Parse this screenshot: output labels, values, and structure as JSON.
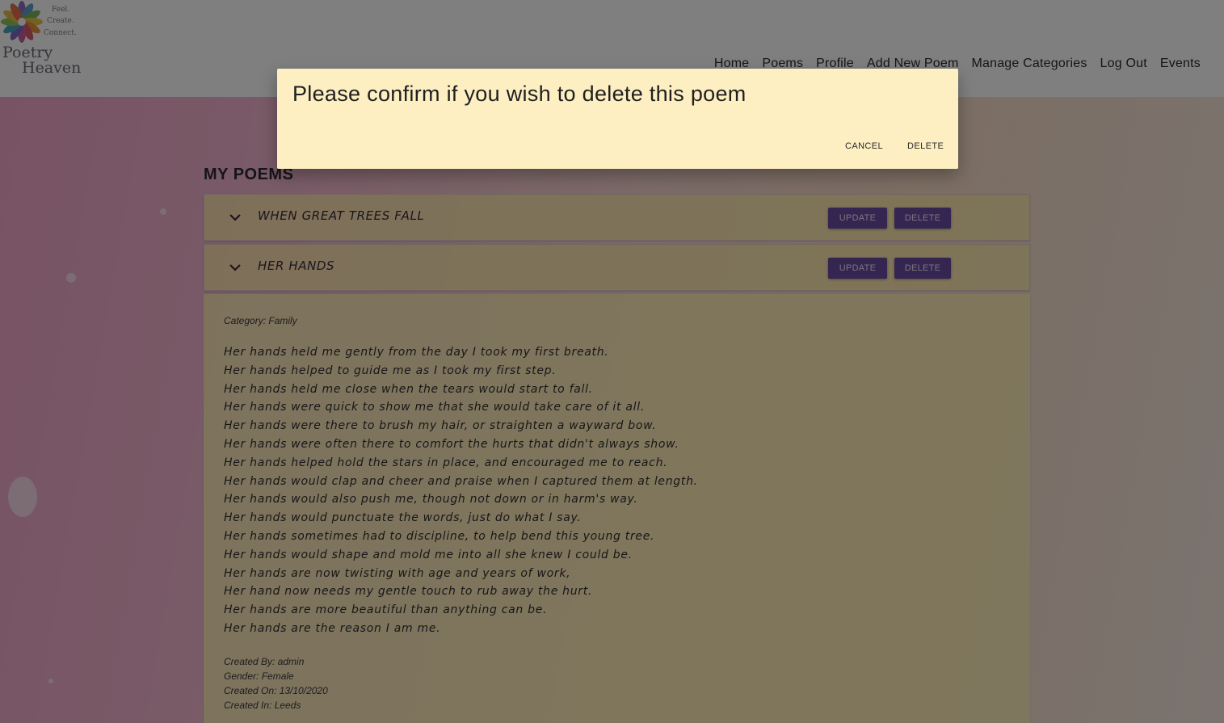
{
  "brand": {
    "taglines": [
      "Feel.",
      "Create.",
      "Connect."
    ],
    "name_line1": "Poetry",
    "name_line2": "Heaven"
  },
  "nav": {
    "items": [
      "Home",
      "Poems",
      "Profile",
      "Add New Poem",
      "Manage Categories",
      "Log Out",
      "Events"
    ]
  },
  "page": {
    "title": "MY POEMS"
  },
  "poems": [
    {
      "title": "WHEN GREAT TREES FALL",
      "update_label": "UPDATE",
      "delete_label": "DELETE",
      "expanded": false
    },
    {
      "title": "HER HANDS",
      "update_label": "UPDATE",
      "delete_label": "DELETE",
      "expanded": true
    }
  ],
  "expanded_poem": {
    "category": "Category: Family",
    "lines": [
      "Her hands held me gently from the day I took my first breath.",
      "Her hands helped to guide me as I took my first step.",
      "Her hands held me close when the tears would start to fall.",
      "Her hands were quick to show me that she would take care of it all.",
      "Her hands were there to brush my hair, or straighten a wayward bow.",
      "Her hands were often there to comfort the hurts that didn't always show.",
      "Her hands helped hold the stars in place, and encouraged me to reach.",
      "Her hands would clap and cheer and praise when I captured them at length.",
      "Her hands would also push me, though not down or in harm's way.",
      "Her hands would punctuate the words, just do what I say.",
      "Her hands sometimes had to discipline, to help bend this young tree.",
      "Her hands would shape and mold me into all she knew I could be.",
      "Her hands are now twisting with age and years of work,",
      "Her hand now needs my gentle touch to rub away the hurt.",
      "Her hands are more beautiful than anything can be.",
      "Her hands are the reason I am me."
    ],
    "created_by": "Created By: admin",
    "gender": "Gender: Female",
    "created_on": "Created On: 13/10/2020",
    "created_in": "Created In: Leeds"
  },
  "modal": {
    "title": "Please confirm if you wish to delete this poem",
    "cancel_label": "CANCEL",
    "delete_label": "DELETE"
  },
  "colors": {
    "button": "#6a4aa3",
    "modal_bg": "#fdefc2",
    "card_bg": "#ffecaa"
  }
}
